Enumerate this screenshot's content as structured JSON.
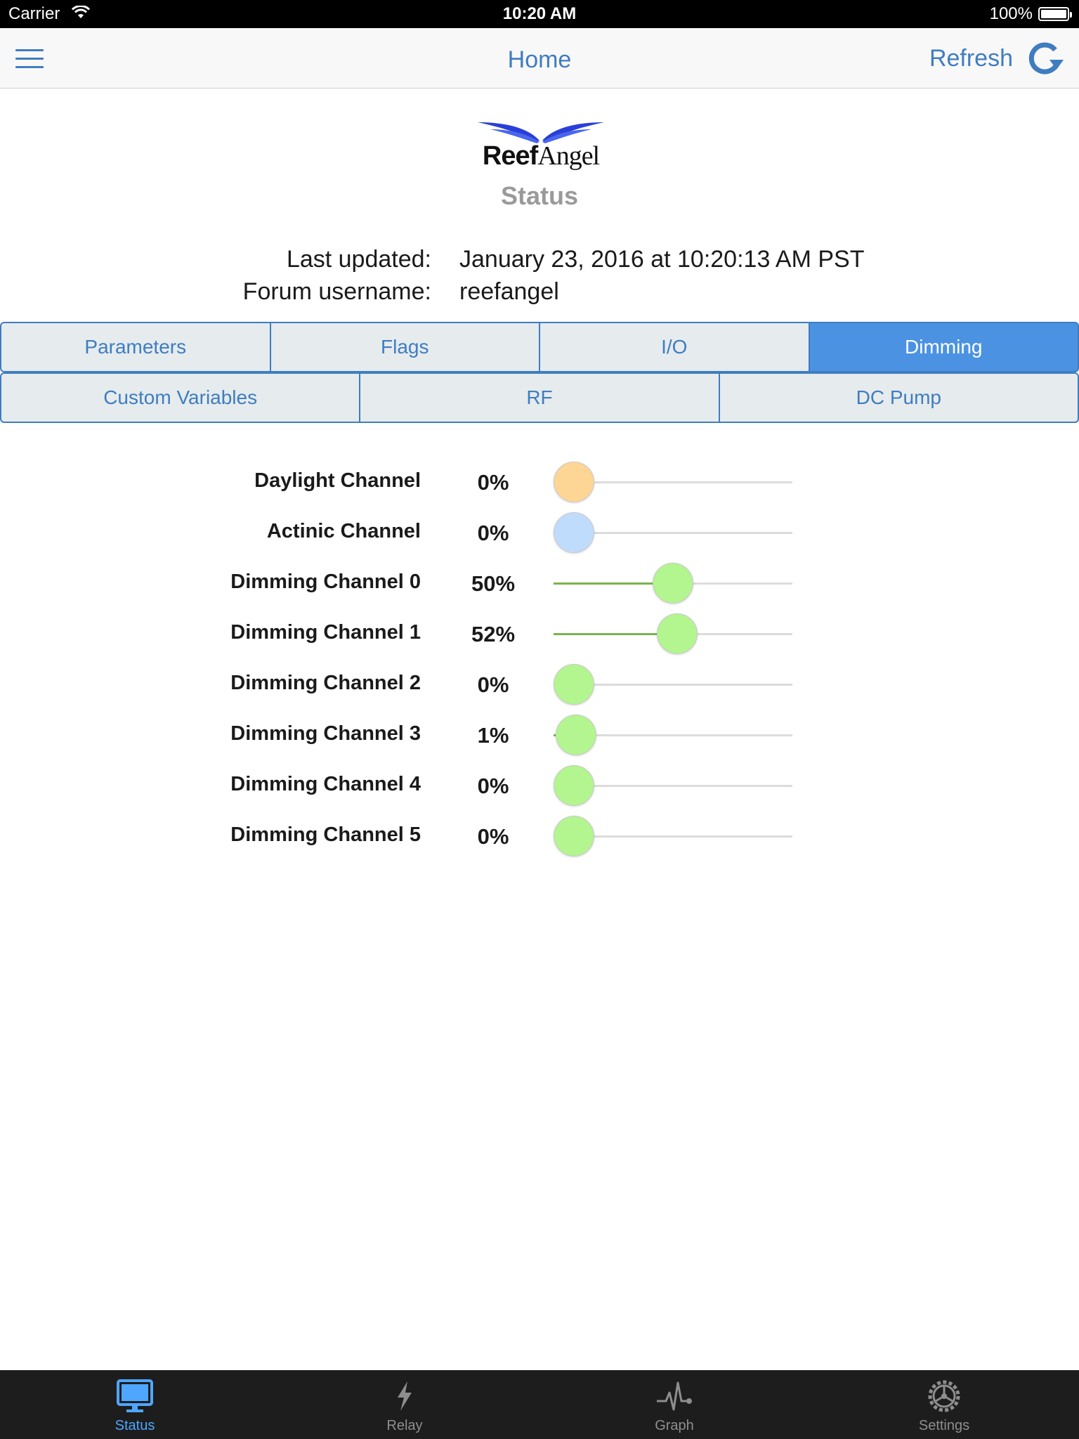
{
  "status_bar": {
    "carrier": "Carrier",
    "time": "10:20 AM",
    "battery": "100%"
  },
  "nav": {
    "title": "Home",
    "refresh_label": "Refresh"
  },
  "header": {
    "logo_text_bold": "Reef",
    "logo_text": "Angel",
    "subtitle": "Status",
    "last_updated_label": "Last updated:",
    "last_updated_value": "January 23, 2016 at 10:20:13 AM PST",
    "username_label": "Forum username:",
    "username_value": "reefangel"
  },
  "tabs_row1": [
    {
      "label": "Parameters",
      "active": false
    },
    {
      "label": "Flags",
      "active": false
    },
    {
      "label": "I/O",
      "active": false
    },
    {
      "label": "Dimming",
      "active": true
    }
  ],
  "tabs_row2": [
    {
      "label": "Custom Variables",
      "active": false
    },
    {
      "label": "RF",
      "active": false
    },
    {
      "label": "DC Pump",
      "active": false
    }
  ],
  "channels": [
    {
      "label": "Daylight Channel",
      "percent_text": "0%",
      "value": 0,
      "color": "#fdd594"
    },
    {
      "label": "Actinic Channel",
      "percent_text": "0%",
      "value": 0,
      "color": "#bfdcfd"
    },
    {
      "label": "Dimming Channel 0",
      "percent_text": "50%",
      "value": 50,
      "color": "#b3f58f"
    },
    {
      "label": "Dimming Channel 1",
      "percent_text": "52%",
      "value": 52,
      "color": "#b3f58f"
    },
    {
      "label": "Dimming Channel 2",
      "percent_text": "0%",
      "value": 0,
      "color": "#b3f58f"
    },
    {
      "label": "Dimming Channel 3",
      "percent_text": "1%",
      "value": 1,
      "color": "#b3f58f"
    },
    {
      "label": "Dimming Channel 4",
      "percent_text": "0%",
      "value": 0,
      "color": "#b3f58f"
    },
    {
      "label": "Dimming Channel 5",
      "percent_text": "0%",
      "value": 0,
      "color": "#b3f58f"
    }
  ],
  "tabbar": [
    {
      "label": "Status",
      "icon": "monitor-icon",
      "active": true
    },
    {
      "label": "Relay",
      "icon": "lightning-icon",
      "active": false
    },
    {
      "label": "Graph",
      "icon": "graph-icon",
      "active": false
    },
    {
      "label": "Settings",
      "icon": "gear-icon",
      "active": false
    }
  ],
  "colors": {
    "accent": "#3f7dc0",
    "active_tab": "#4b92e2",
    "slider_fill": "#7bb34f",
    "tabbar_active": "#4ea6ff"
  }
}
